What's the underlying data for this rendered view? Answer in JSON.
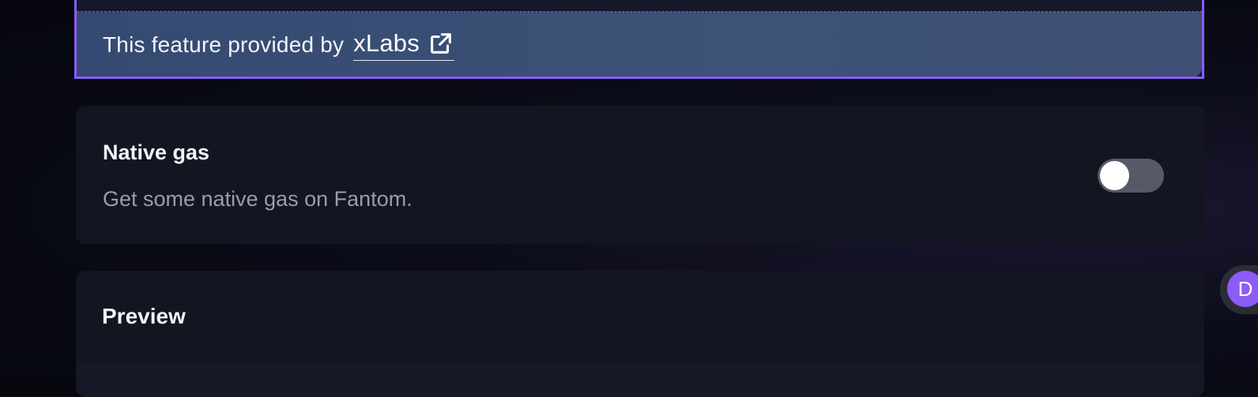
{
  "provider": {
    "text": "This feature provided by",
    "link_label": "xLabs",
    "link_icon": "external-link-icon"
  },
  "native_gas": {
    "title": "Native gas",
    "description": "Get some native gas on Fantom.",
    "toggle_on": false
  },
  "preview": {
    "title": "Preview"
  },
  "avatar": {
    "initial": "D",
    "color": "#8b5cf6"
  },
  "colors": {
    "accent": "#8b5cf6",
    "banner": "#3a4f75",
    "card": "#131521",
    "toggle_off": "#565966"
  }
}
